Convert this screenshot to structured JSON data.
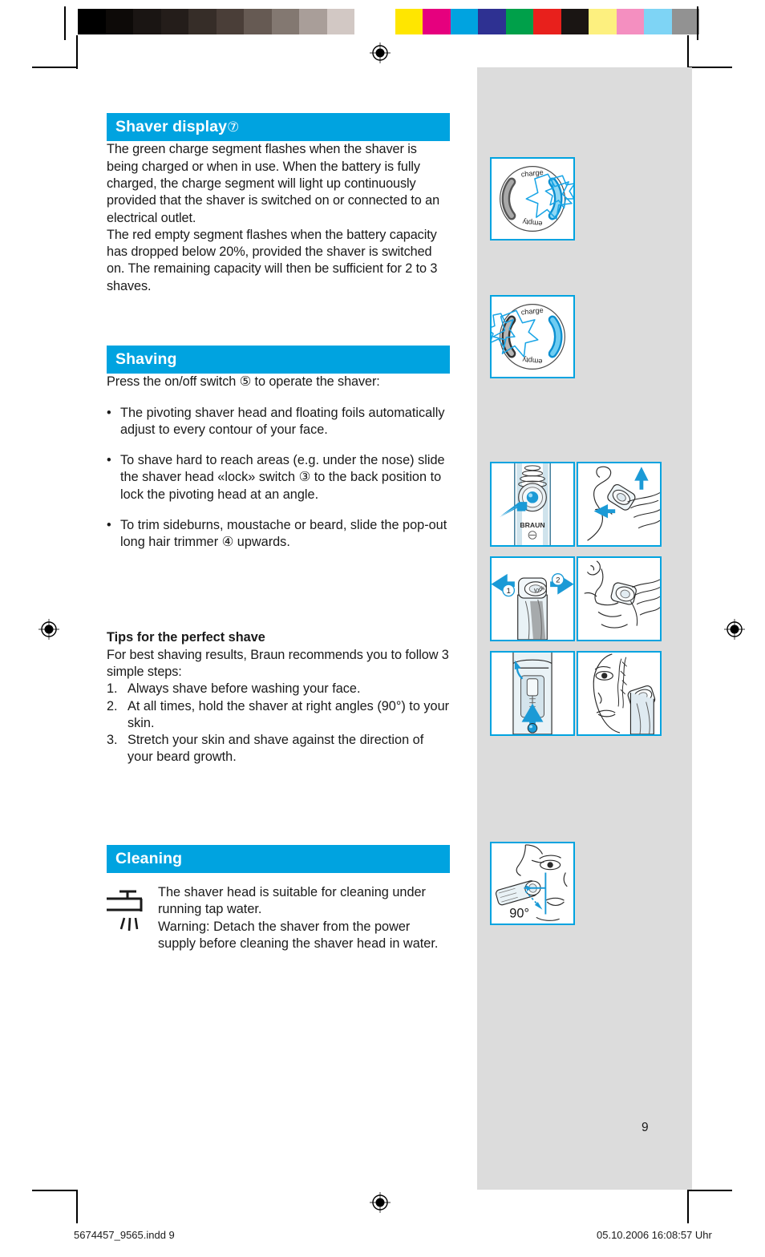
{
  "page": {
    "number": "9",
    "accent_color": "#00a3e0",
    "panel_color": "#dcdcdc"
  },
  "calibration_strip": {
    "name": "print-color-calibration-bar",
    "grayscale": [
      "#000000",
      "#0d0a08",
      "#1a1513",
      "#241d1a",
      "#362d28",
      "#4a3e38",
      "#665a53",
      "#837871",
      "#a99e99",
      "#d2c8c4",
      "#ffffff"
    ],
    "colors": [
      "#ffe600",
      "#e6007e",
      "#00a3e0",
      "#2e3192",
      "#00a04a",
      "#e8201c",
      "#1a1513",
      "#fdf07f",
      "#f48fc0",
      "#7ed4f5",
      "#929292"
    ]
  },
  "sections": [
    {
      "id": "shaver-display",
      "heading": "Shaver display",
      "heading_ref": "⑦",
      "paragraphs": [
        "The green charge segment flashes when the shaver is being charged or when in use. When the battery is fully charged, the charge segment will light up continuously provided that the shaver is switched on or connected to an electrical outlet.",
        "The red empty segment flashes when the battery capacity has dropped below 20%, provided the shaver is switched on. The remaining capacity will then be sufficient for 2 to 3 shaves."
      ]
    },
    {
      "id": "shaving",
      "heading": "Shaving",
      "heading_ref": "",
      "intro": "Press the on/off switch ⑤ to operate the shaver:",
      "bullets": [
        "The pivoting shaver head and floating foils automatically adjust to every contour of your face.",
        "To shave hard to reach areas (e.g. under the nose) slide the shaver head «lock» switch ③ to the back position to lock the pivoting head at an angle.",
        "To trim sideburns, moustache or beard, slide the pop-out long hair trimmer ④ upwards."
      ],
      "tips": {
        "title": "Tips for the perfect shave",
        "intro": "For best shaving results, Braun recommends you to follow 3 simple steps:",
        "steps": [
          {
            "num": "1.",
            "text": "Always shave before washing your face."
          },
          {
            "num": "2.",
            "text": "At all times, hold the shaver at right angles (90°) to your skin."
          },
          {
            "num": "3.",
            "text": "Stretch your skin and shave against the direction of your beard growth."
          }
        ]
      }
    },
    {
      "id": "cleaning",
      "heading": "Cleaning",
      "heading_ref": "",
      "body": "The shaver head is suitable for cleaning under  running tap water.\nWarning: Detach the shaver from the power supply before cleaning the shaver head in water."
    }
  ],
  "figures": {
    "display_charge": {
      "name": "charge-segment-flashing-diagram",
      "label_charge": "charge",
      "label_empty": "empty"
    },
    "display_empty": {
      "name": "empty-segment-flashing-diagram",
      "label_charge": "charge",
      "label_empty": "empty"
    },
    "shaver_grid": [
      {
        "name": "press-on-off-switch-illustration",
        "brand": "BRAUN"
      },
      {
        "name": "pivoting-head-contour-illustration"
      },
      {
        "name": "lock-switch-positions-illustration",
        "step1": "1",
        "step2": "2",
        "lock_label": "lock"
      },
      {
        "name": "shaving-under-nose-illustration"
      },
      {
        "name": "long-hair-trimmer-slide-illustration"
      },
      {
        "name": "trimming-sideburns-illustration"
      }
    ],
    "angle_figure": {
      "name": "right-angle-shaving-illustration",
      "label": "90°"
    }
  },
  "footer": {
    "left": "5674457_9565.indd   9",
    "right": "05.10.2006   16:08:57 Uhr"
  }
}
